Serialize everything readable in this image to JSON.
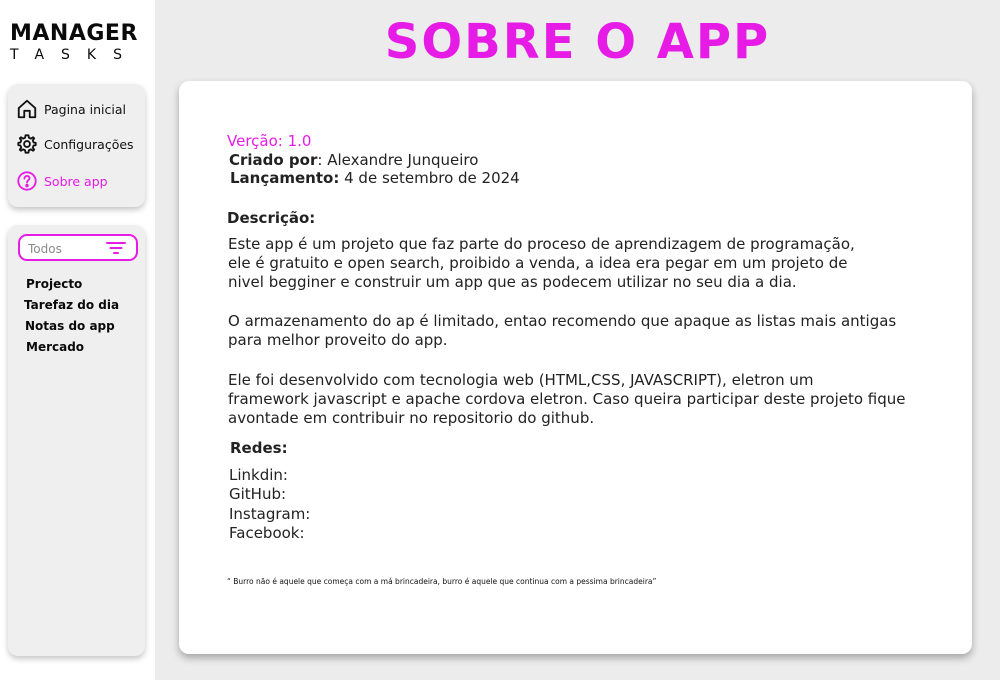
{
  "app": {
    "logo_main": "MANAGER",
    "logo_sub": "TASKS",
    "accent_color": "#e61ce6"
  },
  "nav": {
    "items": [
      {
        "label": "Pagina inicial",
        "icon": "home-icon"
      },
      {
        "label": "Configurações",
        "icon": "gear-icon"
      },
      {
        "label": "Sobre app",
        "icon": "help-circle-icon",
        "active": true
      }
    ]
  },
  "filter": {
    "placeholder": "Todos",
    "icon": "filter-icon"
  },
  "projects": [
    "Projecto",
    "Tarefaz do dia",
    "Notas do app",
    "Mercado"
  ],
  "main": {
    "title": "SOBRE O APP",
    "version_label": "Verção:",
    "version_value": " 1.0",
    "creator_label": "Criado por",
    "creator_value": ": Alexandre Junqueiro",
    "launch_label": "Lançamento:",
    "launch_value": " 4 de setembro de 2024",
    "description_heading": "Descrição:",
    "paragraph_1": "Este app é um projeto que faz parte  do proceso de aprendizagem de programação,\nele é gratuito e open search, proibido a venda, a idea era pegar em um projeto de\nnivel begginer e construir um app que as podecem utilizar no seu dia a dia.",
    "paragraph_2": "O armazenamento do ap é limitado, entao recomendo que apaque as listas mais antigas\npara melhor proveito do app.",
    "paragraph_3": "Ele foi desenvolvido com tecnologia web (HTML,CSS, JAVASCRIPT), eletron um\nframework javascript e apache cordova eletron. Caso queira participar deste projeto fique\navontade em contribuir no repositorio do github.",
    "networks_heading": "Redes:",
    "networks": [
      "Linkdin:",
      "GitHub:",
      "Instagram:",
      "Facebook:"
    ],
    "quote": "“ Burro não é aquele que começa com a má brincadeira, burro é aquele que continua com a pessima brincadeira”"
  }
}
